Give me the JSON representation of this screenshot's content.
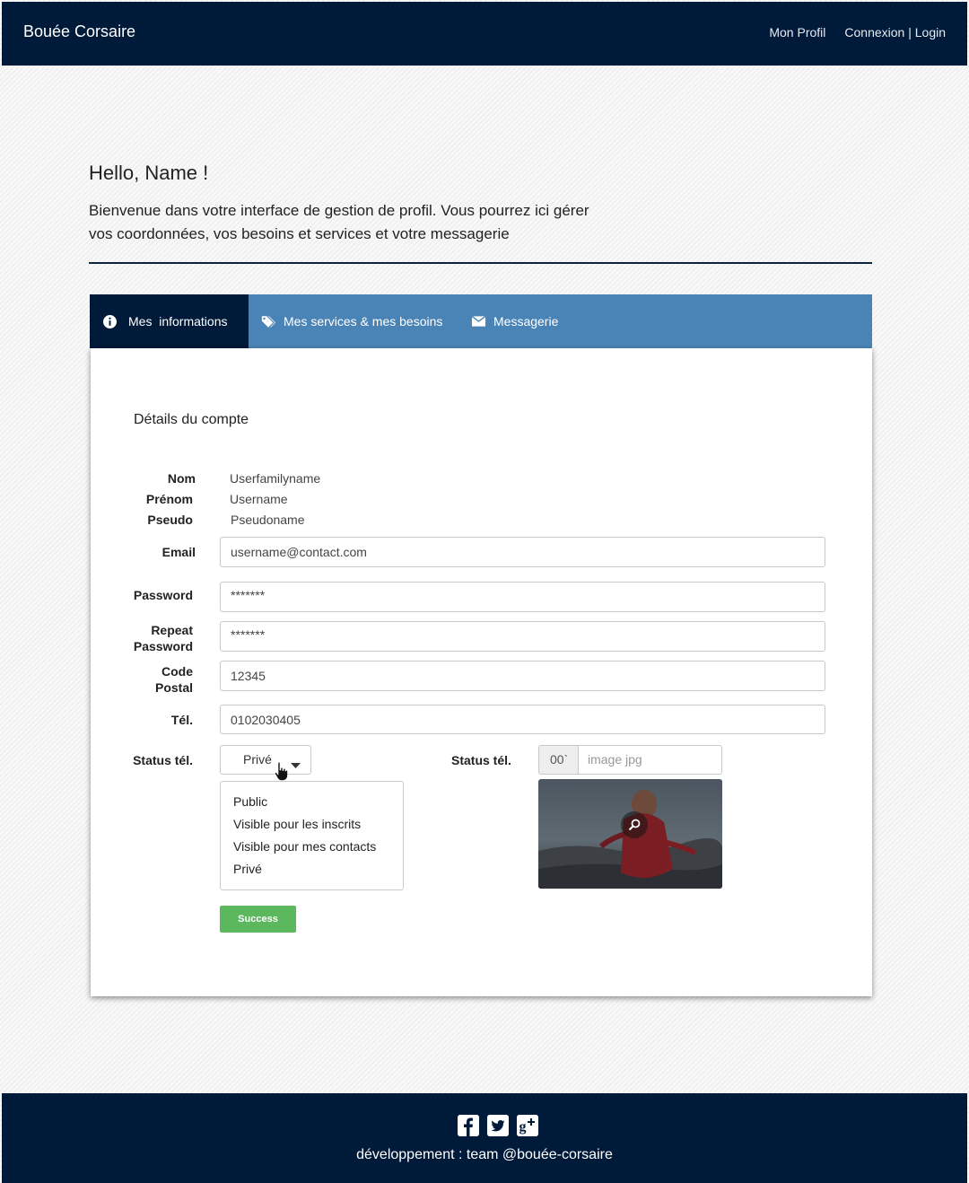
{
  "navbar": {
    "brand": "Bouée Corsaire",
    "links": [
      "Mon Profil",
      "Connexion | Login"
    ]
  },
  "header": {
    "greeting": "Hello, Name !",
    "intro_line1": "Bienvenue dans votre interface de gestion de profil. Vous pourrez ici gérer",
    "intro_line2": "vos coordonnées, vos besoins et services et votre messagerie"
  },
  "tabs": [
    {
      "label": "Mes  informations",
      "icon": "info-icon",
      "active": true
    },
    {
      "label": "Mes services & mes besoins",
      "icon": "tags-icon",
      "active": false
    },
    {
      "label": "Messagerie",
      "icon": "envelope-icon",
      "active": false
    }
  ],
  "panel": {
    "title": "Détails du compte",
    "static_fields": [
      {
        "label": "Nom",
        "value": "Userfamilyname"
      },
      {
        "label": "Prénom",
        "value": "Username"
      },
      {
        "label": "Pseudo",
        "value": "Pseudoname"
      }
    ],
    "email": {
      "label": "Email",
      "value": "username@contact.com"
    },
    "password": {
      "label": "Password",
      "value": "*******"
    },
    "repeat_password": {
      "label_line1": "Repeat",
      "label_line2": "Password",
      "value": "*******"
    },
    "code_postal": {
      "label_line1": "Code",
      "label_line2": "Postal",
      "value": "12345"
    },
    "tel": {
      "label": "Tél.",
      "value": "0102030405"
    },
    "status_tel": {
      "label": "Status tél.",
      "selected": "Privé",
      "options": [
        "Public",
        "Visible pour les inscrits",
        "Visible pour mes contacts",
        "Privé"
      ]
    },
    "status_tel_image": {
      "label": "Status tél.",
      "prefix": "00`",
      "placeholder": "image jpg"
    },
    "submit_label": "Success"
  },
  "footer": {
    "social_icons": [
      "facebook-icon",
      "twitter-icon",
      "google-plus-icon"
    ],
    "credit": "développement : team @bouée-corsaire"
  },
  "colors": {
    "navy": "#001a3a",
    "tab_blue": "#4a84b6",
    "success": "#5cb85c"
  }
}
